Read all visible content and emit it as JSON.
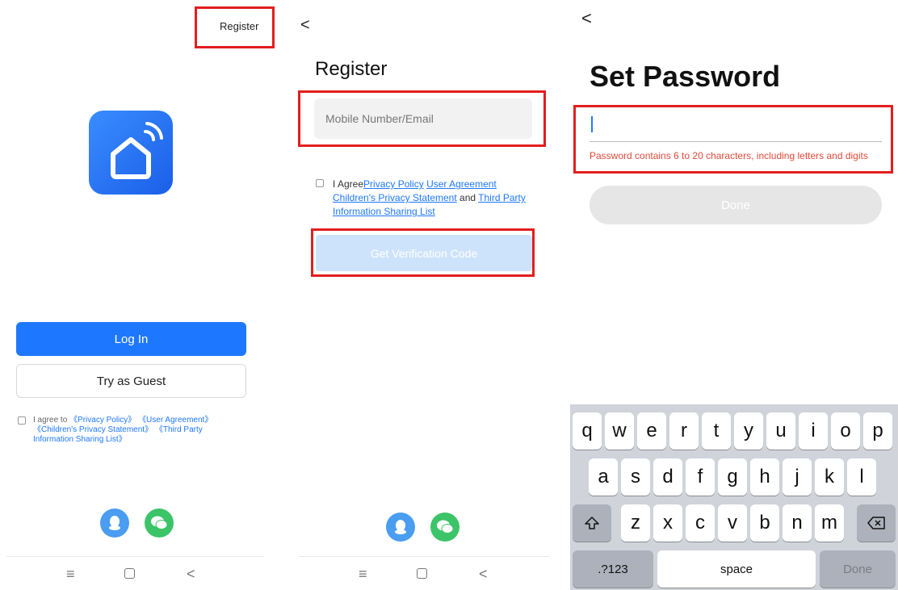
{
  "colors": {
    "primary": "#1e78ff",
    "highlight": "#e31e1e",
    "disabled_button": "#cde3fb",
    "qq": "#4a9df0",
    "wechat": "#3cc468"
  },
  "login_screen": {
    "register_link": "Register",
    "app_icon": "smart-home-icon",
    "login_button": "Log In",
    "guest_button": "Try as Guest",
    "agreement": {
      "prefix": "I agree to ",
      "privacy_policy": "《Privacy Policy》",
      "user_agreement": "《User Agreement》",
      "children_privacy": "《Children's Privacy Statement》",
      "third_party": "《Third Party Information Sharing List》"
    },
    "social_icons": [
      "qq-icon",
      "wechat-icon"
    ],
    "nav": [
      "menu-icon",
      "home-icon",
      "back-icon"
    ]
  },
  "register_screen": {
    "back": "<",
    "title": "Register",
    "input_placeholder": "Mobile Number/Email",
    "agreement": {
      "prefix": "I Agree",
      "privacy_policy": "Privacy Policy",
      "user_agreement": "User Agreement",
      "children_privacy": "Children's Privacy Statement",
      "and": " and ",
      "third_party": "Third Party Information Sharing List"
    },
    "get_code_button": "Get Verification Code",
    "social_icons": [
      "qq-icon",
      "wechat-icon"
    ],
    "nav": [
      "menu-icon",
      "home-icon",
      "back-icon"
    ]
  },
  "password_screen": {
    "back": "<",
    "title": "Set Password",
    "hint": "Password contains 6 to 20 characters, including letters and digits",
    "done_button": "Done",
    "keyboard": {
      "row1": [
        "q",
        "w",
        "e",
        "r",
        "t",
        "y",
        "u",
        "i",
        "o",
        "p"
      ],
      "row2": [
        "a",
        "s",
        "d",
        "f",
        "g",
        "h",
        "j",
        "k",
        "l"
      ],
      "row3": [
        "z",
        "x",
        "c",
        "v",
        "b",
        "n",
        "m"
      ],
      "numbers_key": ".?123",
      "space_key": "space",
      "done_key": "Done"
    }
  }
}
